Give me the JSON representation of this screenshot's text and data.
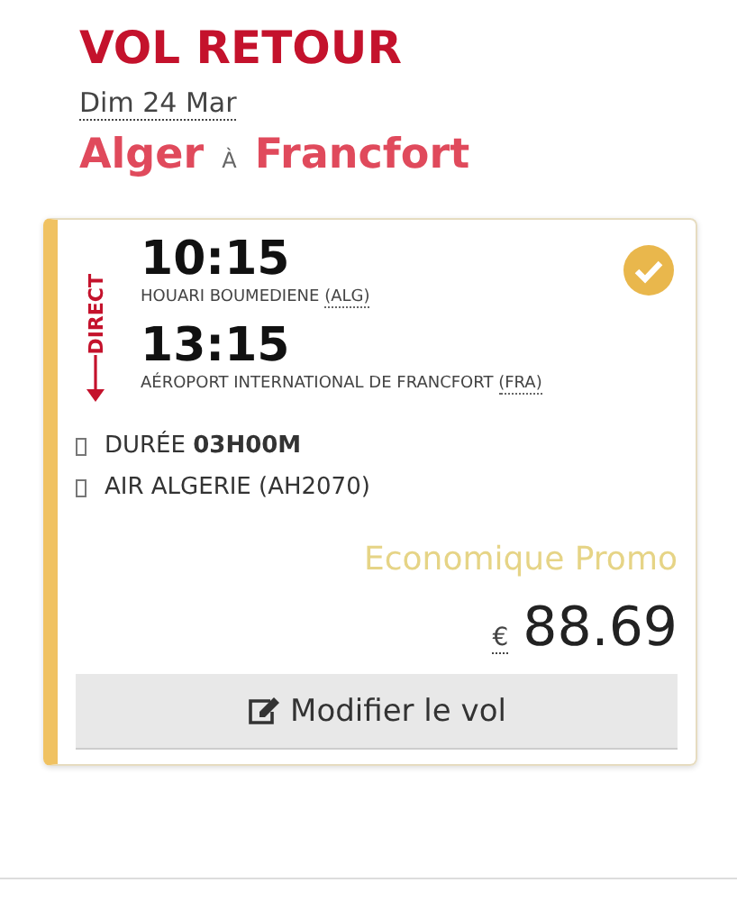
{
  "heading": "VOL RETOUR",
  "date": "Dim 24 Mar",
  "route": {
    "from": "Alger",
    "connector": "À",
    "to": "Francfort"
  },
  "flight": {
    "stop_label": "DIRECT",
    "selected": true,
    "departure": {
      "time": "10:15",
      "airport": "HOUARI BOUMEDIENE",
      "code": "(ALG)"
    },
    "arrival": {
      "time": "13:15",
      "airport": "AÉROPORT INTERNATIONAL DE FRANCFORT",
      "code": "(FRA)"
    },
    "details": [
      "DURÉE **03H00M**",
      "AIR ALGERIE (AH2070)"
    ],
    "fare_class": "Economique Promo",
    "currency": "€",
    "price": "88.69",
    "button": "Modifier le vol"
  }
}
